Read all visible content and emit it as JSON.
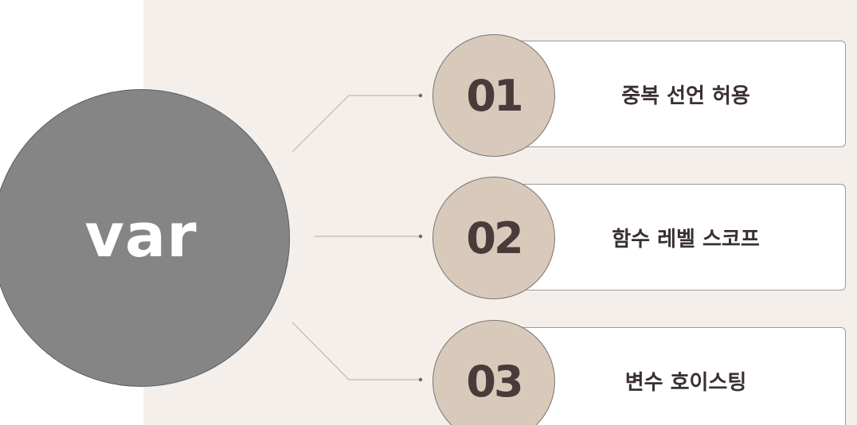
{
  "diagram": {
    "main_label": "var",
    "items": [
      {
        "number": "01",
        "label": "중복 선언 허용"
      },
      {
        "number": "02",
        "label": "함수 레벨 스코프"
      },
      {
        "number": "03",
        "label": "변수 호이스팅"
      }
    ]
  },
  "colors": {
    "main_circle": "#858585",
    "badge_fill": "#d9c9bb",
    "panel_background": "#f4efeb",
    "text_dark": "#3a3030"
  }
}
